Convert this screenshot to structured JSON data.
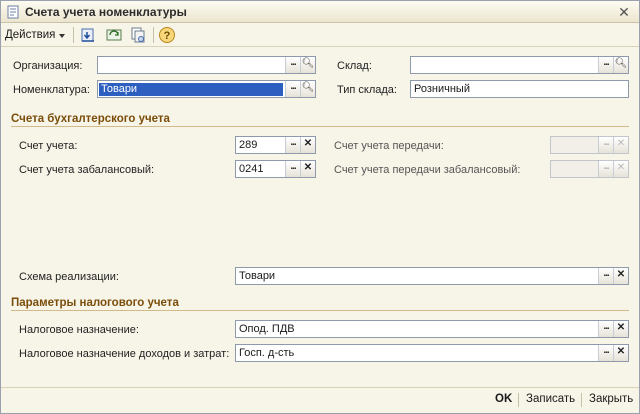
{
  "window": {
    "title": "Счета учета номенклатуры"
  },
  "toolbar": {
    "actions_label": "Действия"
  },
  "header": {
    "org_label": "Организация:",
    "org_value": "",
    "warehouse_label": "Склад:",
    "warehouse_value": "",
    "nomenclature_label": "Номенклатура:",
    "nomenclature_value": "Товари",
    "warehouse_type_label": "Тип склада:",
    "warehouse_type_value": "Розничный"
  },
  "accounting": {
    "section_title": "Счета бухгалтерского учета",
    "account_label": "Счет учета:",
    "account_value": "289",
    "offbalance_label": "Счет учета забалансовый:",
    "offbalance_value": "0241",
    "transfer_label": "Счет учета передачи:",
    "transfer_value": "",
    "transfer_offbalance_label": "Счет учета передачи забалансовый:",
    "transfer_offbalance_value": "",
    "sale_scheme_label": "Схема реализации:",
    "sale_scheme_value": "Товари"
  },
  "tax": {
    "section_title": "Параметры налогового учета",
    "purpose_label": "Налоговое назначение:",
    "purpose_value": "Опод. ПДВ",
    "income_purpose_label": "Налоговое назначение доходов и затрат:",
    "income_purpose_value": "Госп. д-сть"
  },
  "footer": {
    "ok_label": "OK",
    "save_label": "Записать",
    "close_label": "Закрыть"
  },
  "icons": {
    "search": "magnifier-icon",
    "dots": "ellipsis-icon",
    "clear": "clear-x-icon",
    "help": "help-icon",
    "close": "close-icon"
  },
  "colors": {
    "section_title": "#7a4e0a",
    "selection": "#2c5fbf",
    "window_bg": "#f7f4e8"
  }
}
